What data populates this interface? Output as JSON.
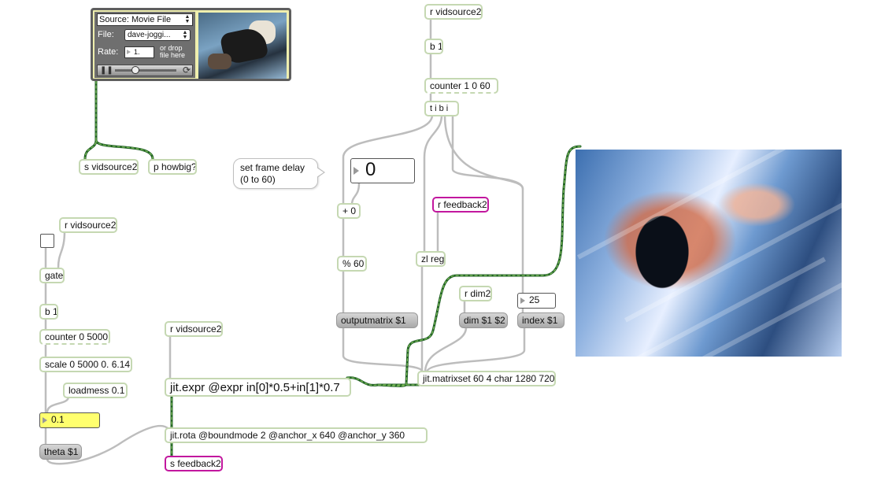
{
  "player": {
    "source": "Source: Movie File",
    "file_label": "File:",
    "file_value": "dave-joggi...",
    "rate_label": "Rate:",
    "rate_value": "1.",
    "drop_hint": "or drop file here",
    "icons": [
      "pause-icon",
      "playhead-icon",
      "loop-icon"
    ]
  },
  "objects": {
    "r_vidsource2_top": "r vidsource2",
    "b1_top": "b 1",
    "counter_1_0_60": "counter 1 0 60",
    "t_i_b_i": "t i b i",
    "s_vidsource2": "s vidsource2",
    "p_howbig": "p howbig?",
    "plus0": "+ 0",
    "mod60": "% 60",
    "r_feedback2": "r feedback2",
    "zl_reg": "zl reg",
    "r_dim2": "r dim2",
    "r_vidsource2_left": "r vidsource2",
    "gate": "gate",
    "b1_left": "b 1",
    "counter_0_5000": "counter 0 5000",
    "scale": "scale 0 5000 0. 6.14",
    "loadmess": "loadmess 0.1",
    "r_vidsource2_mid": "r vidsource2",
    "jit_expr": "jit.expr @expr in[0]*0.5+in[1]*0.7",
    "jit_matrixset": "jit.matrixset 60 4 char 1280 720",
    "jit_rota": "jit.rota @boundmode 2 @anchor_x 640 @anchor_y 360",
    "s_feedback2": "s feedback2"
  },
  "messages": {
    "outputmatrix": "outputmatrix $1",
    "dim": "dim $1 $2",
    "index": "index $1",
    "theta": "theta $1"
  },
  "numbers": {
    "frame_delay": "0",
    "index_value": "25",
    "theta_value": "0.1"
  },
  "comment": {
    "text_line1": "set frame delay",
    "text_line2": "(0 to 60)"
  },
  "colors": {
    "object_border": "#c5d8b2",
    "send_receive_border": "#c2179e",
    "patch_cord": "#b9b9b9",
    "jitter_cord": "#2e7d32",
    "number_yellow": "#ffff6e"
  }
}
